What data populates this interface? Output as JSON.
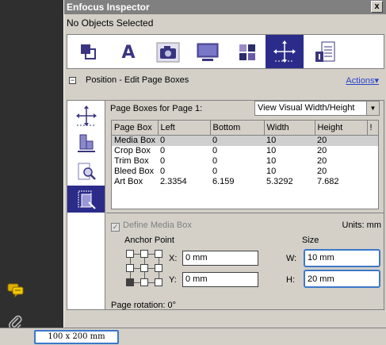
{
  "window": {
    "title": "Enfocus Inspector",
    "close_label": "x"
  },
  "selection_status": "No Objects Selected",
  "toolstrip": {
    "tools": [
      {
        "icon": "object-transform-icon"
      },
      {
        "icon": "text-icon",
        "glyph": "A"
      },
      {
        "icon": "camera-icon"
      },
      {
        "icon": "monitor-icon"
      },
      {
        "icon": "color-swatch-icon"
      },
      {
        "icon": "position-move-icon",
        "active": true
      },
      {
        "icon": "document-info-icon"
      }
    ]
  },
  "section": {
    "collapse_glyph": "−",
    "title": "Position - Edit Page Boxes",
    "actions_label": "Actions▾"
  },
  "page_boxes": {
    "label": "Page Boxes for Page 1:",
    "view_select": "View Visual Width/Height",
    "columns": [
      "Page Box",
      "Left",
      "Bottom",
      "Width",
      "Height",
      "!"
    ],
    "rows": [
      [
        "Media Box",
        "0",
        "0",
        "10",
        "20"
      ],
      [
        "Crop Box",
        "0",
        "0",
        "10",
        "20"
      ],
      [
        "Trim Box",
        "0",
        "0",
        "10",
        "20"
      ],
      [
        "Bleed Box",
        "0",
        "0",
        "10",
        "20"
      ],
      [
        "Art Box",
        "2.3354",
        "6.159",
        "5.3292",
        "7.682"
      ]
    ]
  },
  "define_media_box": {
    "label": "Define Media Box",
    "checked": true,
    "enabled": false
  },
  "units": "Units: mm",
  "anchor": {
    "label": "Anchor Point",
    "x_label": "X:",
    "x_value": "0 mm",
    "y_label": "Y:",
    "y_value": "0 mm"
  },
  "size": {
    "label": "Size",
    "w_label": "W:",
    "w_value": "10 mm",
    "h_label": "H:",
    "h_value": "20 mm"
  },
  "page_rotation": "Page rotation: 0°",
  "status_bar": {
    "zoom": "100 x 200 mm"
  },
  "colors": {
    "accent": "#2b2c8a",
    "focus": "#3c78c8",
    "link": "#2a46c8"
  }
}
